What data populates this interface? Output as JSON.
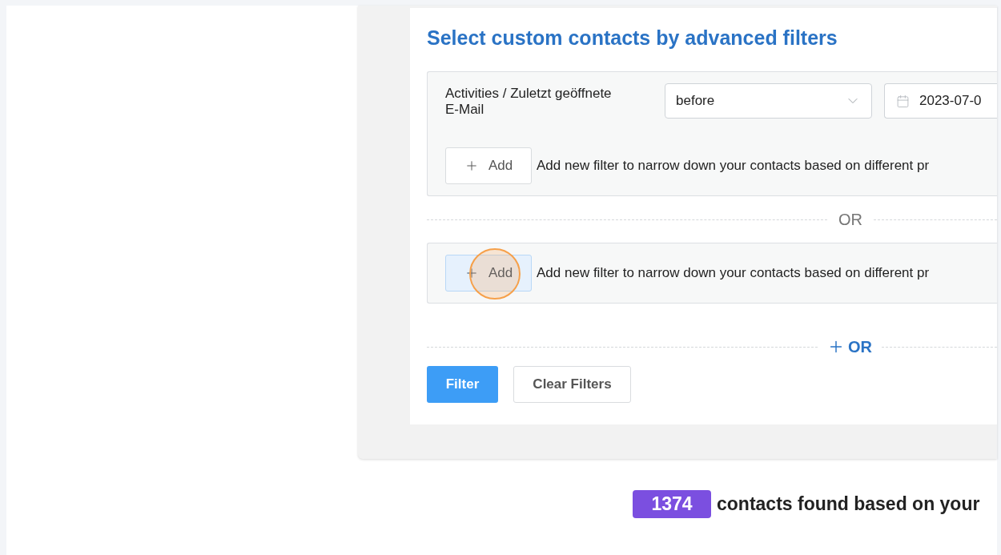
{
  "heading": "Select custom contacts by advanced filters",
  "groups": [
    {
      "filters": [
        {
          "field": "Activities / Zuletzt geöffnete E-Mail",
          "operator": "before",
          "date": "2023-07-0"
        }
      ],
      "add_button": {
        "label": "Add",
        "highlighted": false
      },
      "hint": "Add new filter to narrow down your contacts based on different pr"
    },
    {
      "add_button": {
        "label": "Add",
        "highlighted": true
      },
      "hint": "Add new filter to narrow down your contacts based on different pr"
    }
  ],
  "separator": "OR",
  "add_or": {
    "label": "OR"
  },
  "buttons": [
    {
      "label": "Filter",
      "kind": "primary"
    },
    {
      "label": "Clear Filters",
      "kind": "secondary"
    }
  ],
  "result": {
    "count": "1374",
    "text": "contacts found based on your"
  }
}
